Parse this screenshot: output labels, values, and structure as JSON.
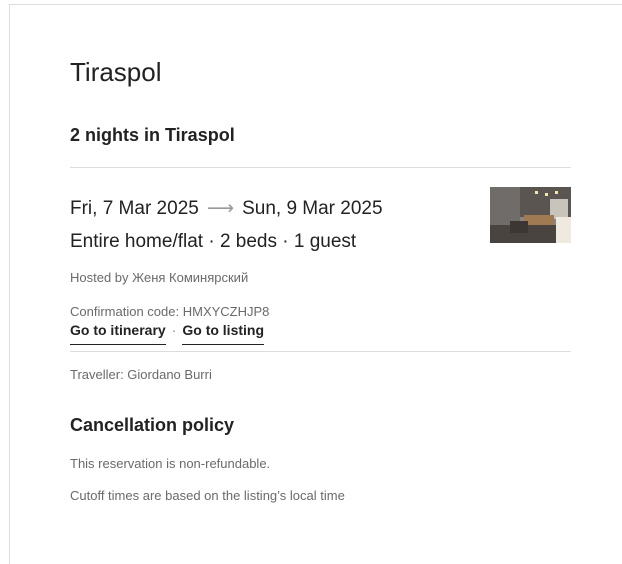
{
  "reservation": {
    "city": "Tiraspol",
    "nights_label": "2 nights in Tiraspol",
    "check_in": "Fri, 7 Mar 2025",
    "arrow": "⟶",
    "check_out": "Sun, 9 Mar 2025",
    "summary": "Entire home/flat · 2 beds · 1 guest",
    "hosted_by": "Hosted by Женя Коминярский",
    "confirmation": "Confirmation code: HMXYCZHJP8",
    "links": {
      "itinerary": "Go to itinerary",
      "separator": "·",
      "listing": "Go to listing"
    },
    "traveller": "Traveller: Giordano Burri"
  },
  "cancellation": {
    "title": "Cancellation policy",
    "line1": "This reservation is non-refundable.",
    "line2": "Cutoff times are based on the listing’s local time"
  },
  "icons": {
    "thumbnail": "listing-photo"
  }
}
